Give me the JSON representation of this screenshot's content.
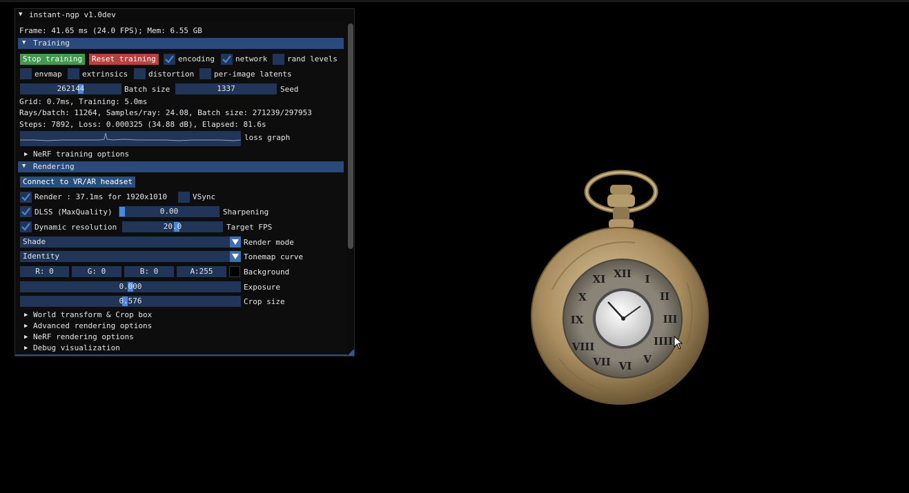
{
  "window": {
    "title": "instant-ngp v1.0dev",
    "frame_info": "Frame: 41.65 ms (24.0 FPS); Mem: 6.55 GB"
  },
  "training": {
    "header": "Training",
    "stop_label": "Stop training",
    "reset_label": "Reset training",
    "checkboxes_row1": [
      {
        "label": "encoding",
        "checked": true
      },
      {
        "label": "network",
        "checked": true
      },
      {
        "label": "rand levels",
        "checked": false
      }
    ],
    "checkboxes_row2": [
      {
        "label": "envmap",
        "checked": false
      },
      {
        "label": "extrinsics",
        "checked": false
      },
      {
        "label": "distortion",
        "checked": false
      },
      {
        "label": "per-image latents",
        "checked": false
      }
    ],
    "batch_size_value": "262144",
    "batch_size_label": "Batch size",
    "seed_value": "1337",
    "seed_label": "Seed",
    "stats_grid": "Grid: 0.7ms, Training: 5.0ms",
    "stats_rays": "Rays/batch: 11264, Samples/ray: 24.08, Batch size: 271239/297953",
    "stats_steps": "Steps: 7892, Loss: 0.000325 (34.88 dB), Elapsed: 81.6s",
    "loss_graph_label": "loss graph",
    "nerf_training_options": "NeRF training options"
  },
  "rendering": {
    "header": "Rendering",
    "connect_label": "Connect to VR/AR headset",
    "render_label": "Render : 37.1ms for 1920x1010",
    "render_checked": true,
    "vsync_label": "VSync",
    "vsync_checked": false,
    "dlss_label": "DLSS (MaxQuality)",
    "dlss_checked": true,
    "sharpening_value": "0.00",
    "sharpening_level": 0.0,
    "sharpening_label": "Sharpening",
    "dynres_label": "Dynamic resolution",
    "dynres_checked": true,
    "target_fps_value": "20.0",
    "target_fps_label": "Target FPS",
    "render_mode_value": "Shade",
    "render_mode_label": "Render mode",
    "tonemap_value": "Identity",
    "tonemap_label": "Tonemap curve",
    "bg_r": "R:  0",
    "bg_g": "G:  0",
    "bg_b": "B:  0",
    "bg_a": "A:255",
    "background_label": "Background",
    "background_color": "#000000",
    "exposure_value": "0.000",
    "exposure_label": "Exposure",
    "crop_value": "0.576",
    "crop_label": "Crop size",
    "collapsed_sections": [
      "World transform & Crop box",
      "Advanced rendering options",
      "NeRF rendering options",
      "Debug visualization"
    ]
  },
  "colors": {
    "header_bg": "#294a7a",
    "widget_bg": "#203557",
    "accent": "#4a88e0",
    "stop_green": "#3f9a4e",
    "reset_red": "#b8403f"
  },
  "icons": [
    "collapse-triangle-icon",
    "expand-triangle-icon",
    "checkmark-icon",
    "dropdown-arrow-icon",
    "mouse-cursor-icon"
  ]
}
